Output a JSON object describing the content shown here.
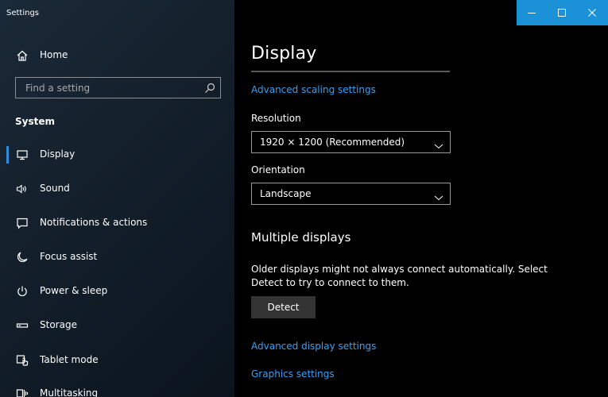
{
  "window": {
    "title": "Settings",
    "controls": {
      "minimize_icon": "minimize-icon",
      "maximize_icon": "maximize-icon",
      "close_icon": "close-icon"
    },
    "accent_color": "#1b92d8"
  },
  "sidebar": {
    "home": {
      "label": "Home",
      "icon": "home-icon"
    },
    "search": {
      "placeholder": "Find a setting",
      "value": "",
      "icon": "search-icon"
    },
    "section_title": "System",
    "items": [
      {
        "label": "Display",
        "icon": "monitor-icon",
        "selected": true
      },
      {
        "label": "Sound",
        "icon": "speaker-icon",
        "selected": false
      },
      {
        "label": "Notifications & actions",
        "icon": "notification-icon",
        "selected": false
      },
      {
        "label": "Focus assist",
        "icon": "moon-icon",
        "selected": false
      },
      {
        "label": "Power & sleep",
        "icon": "power-icon",
        "selected": false
      },
      {
        "label": "Storage",
        "icon": "storage-icon",
        "selected": false
      },
      {
        "label": "Tablet mode",
        "icon": "tablet-mode-icon",
        "selected": false
      },
      {
        "label": "Multitasking",
        "icon": "multitasking-icon",
        "selected": false
      }
    ]
  },
  "main": {
    "page_title": "Display",
    "advanced_scaling_link": "Advanced scaling settings",
    "resolution": {
      "label": "Resolution",
      "value": "1920 × 1200 (Recommended)"
    },
    "orientation": {
      "label": "Orientation",
      "value": "Landscape"
    },
    "multiple_displays": {
      "heading": "Multiple displays",
      "description": "Older displays might not always connect automatically. Select Detect to try to connect to them.",
      "detect_button": "Detect"
    },
    "advanced_display_link": "Advanced display settings",
    "graphics_link": "Graphics settings",
    "link_color": "#3aa0f3"
  }
}
